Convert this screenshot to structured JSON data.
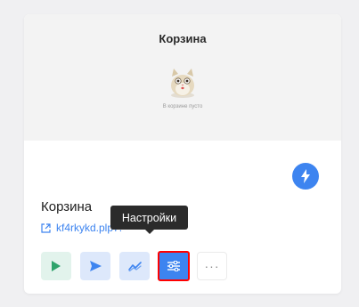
{
  "preview": {
    "title": "Корзина",
    "empty_text": "В корзине пусто"
  },
  "card": {
    "title": "Корзина",
    "link_text": "kf4rkykd.plp7."
  },
  "tooltip": {
    "text": "Настройки"
  },
  "actions": {
    "more_label": "···"
  },
  "icons": {
    "bolt": "lightning-icon",
    "link": "external-link-icon",
    "play": "play-icon",
    "send": "send-icon",
    "stats": "chart-icon",
    "settings": "sliders-icon"
  },
  "colors": {
    "accent": "#3d84f0",
    "play_bg": "#e2f3ec",
    "play_icon": "#2ea36b",
    "soft_blue_bg": "#dde8fb",
    "tooltip_bg": "#2b2b2b",
    "highlight_border": "#ff0000"
  }
}
